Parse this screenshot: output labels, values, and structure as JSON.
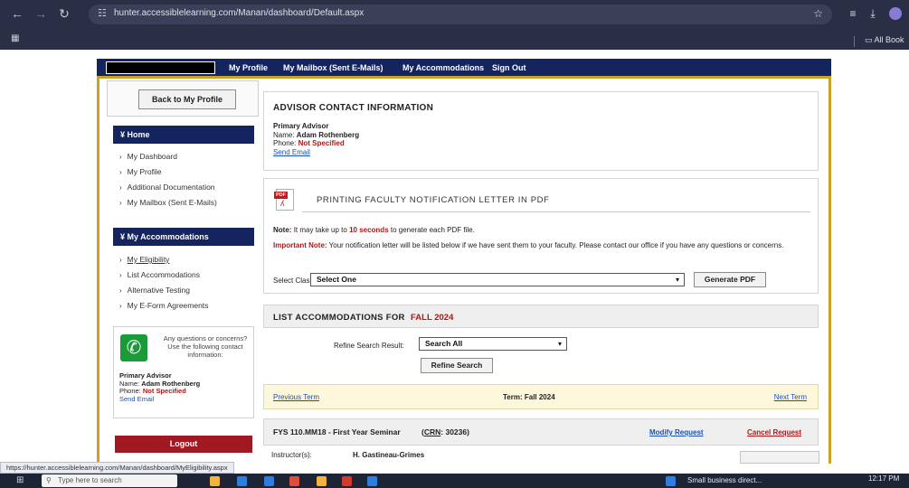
{
  "browser": {
    "url": "hunter.accessiblelearning.com/Manan/dashboard/Default.aspx",
    "bookmarks_label": "All Book"
  },
  "site_nav": {
    "links": [
      "My Profile",
      "My Mailbox (Sent E-Mails)",
      "My Accommodations",
      "Sign Out"
    ]
  },
  "sidebar": {
    "back_button": "Back to My Profile",
    "home_section": "Home",
    "home_items": [
      "My Dashboard",
      "My Profile",
      "Additional Documentation",
      "My Mailbox (Sent E-Mails)"
    ],
    "accommodations_section": "My Accommodations",
    "accommodations_items": [
      "My Eligibility",
      "List Accommodations",
      "Alternative Testing",
      "My E-Form Agreements"
    ],
    "contact": {
      "question": "Any questions or concerns? Use the following contact information:",
      "advisor_heading": "Primary Advisor",
      "name_label": "Name:",
      "name_value": "Adam Rothenberg",
      "phone_label": "Phone:",
      "phone_value": "Not Specified",
      "email_link": "Send Email"
    },
    "logout": "Logout"
  },
  "advisor_panel": {
    "title": "ADVISOR CONTACT INFORMATION",
    "heading": "Primary Advisor",
    "name_label": "Name:",
    "name_value": "Adam Rothenberg",
    "phone_label": "Phone:",
    "phone_value": "Not Specified",
    "email_link": "Send Email"
  },
  "pdf_panel": {
    "title": "PRINTING FACULTY NOTIFICATION LETTER IN PDF",
    "note_label": "Note:",
    "note_text_1": "It may take up to",
    "note_highlight": "10 seconds",
    "note_text_2": "to generate each PDF file.",
    "important_label": "Important Note:",
    "important_text": "Your notification letter will be listed below if we have sent them to your faculty. Please contact our office if you have any questions or concerns.",
    "select_label": "Select Class:",
    "select_value": "Select One",
    "generate_button": "Generate PDF"
  },
  "list_panel": {
    "title_prefix": "LIST ACCOMMODATIONS FOR",
    "title_term": "FALL 2024",
    "refine_label": "Refine Search Result:",
    "refine_value": "Search All",
    "refine_button": "Refine Search"
  },
  "term_bar": {
    "previous": "Previous Term",
    "current": "Term: Fall 2024",
    "next": "Next Term"
  },
  "course": {
    "title": "FYS 110.MM18 - First Year Seminar",
    "crn_label": "CRN",
    "crn_value": "30236",
    "modify": "Modify Request",
    "cancel": "Cancel Request",
    "instructor_label": "Instructor(s):",
    "instructor_value": "H. Gastineau-Grimes"
  },
  "status_url": "https://hunter.accessiblelearning.com/Manan/dashboard/MyEligibility.aspx",
  "taskbar": {
    "search_placeholder": "Type here to search",
    "news": "Small business direct...",
    "time": "12:17 PM"
  },
  "colors": {
    "navy": "#14245e",
    "gold": "#c9a227",
    "red": "#b01616",
    "logout": "#a01822",
    "link": "#1b4fb8"
  }
}
